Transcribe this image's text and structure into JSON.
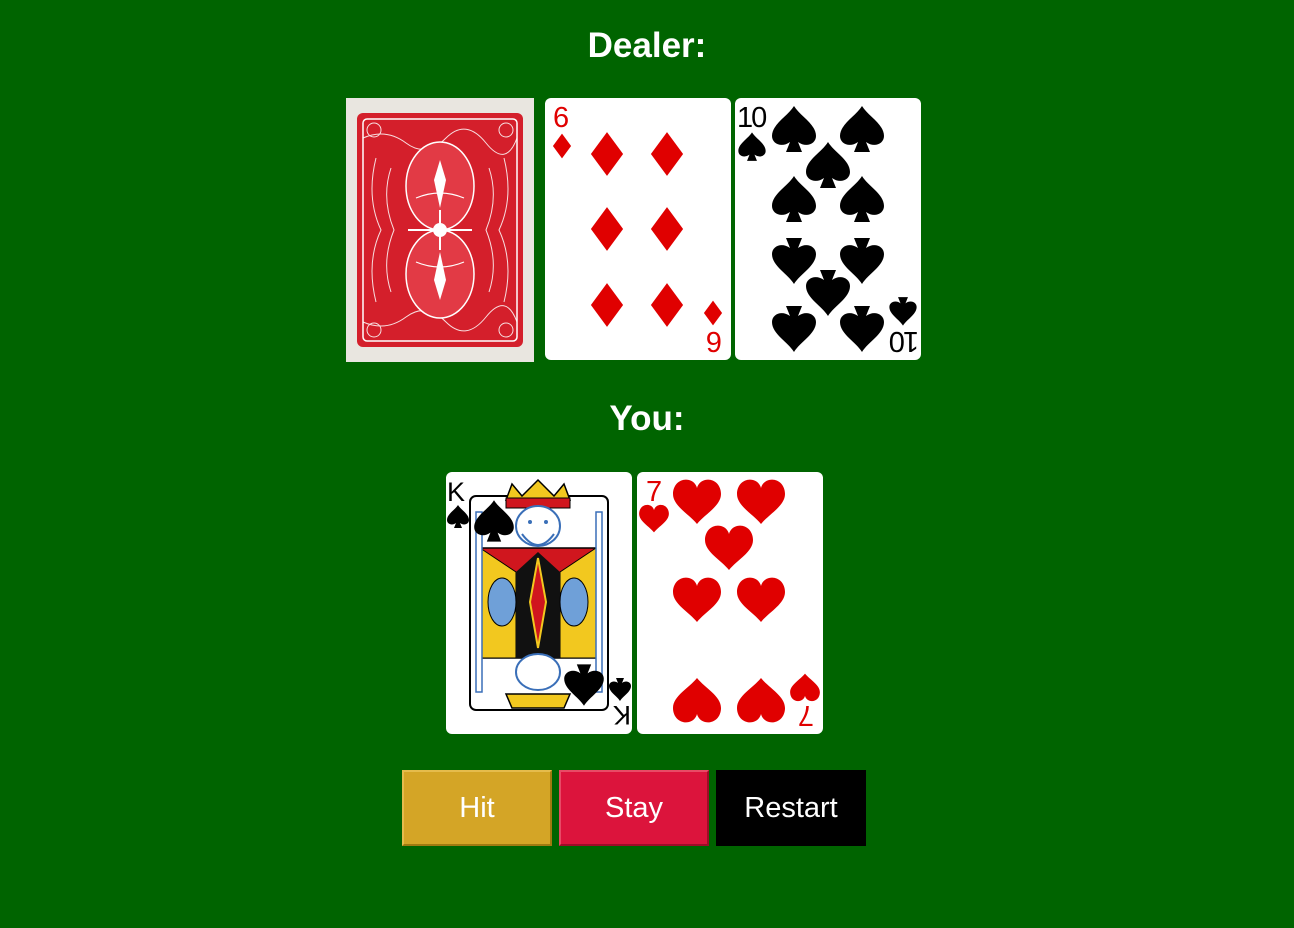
{
  "dealer": {
    "title": "Dealer:",
    "cards": [
      {
        "face": "back",
        "color": "red"
      },
      {
        "rank": "6",
        "suit": "diamonds",
        "suit_symbol": "♦",
        "color": "#E00000"
      },
      {
        "rank": "10",
        "suit": "spades",
        "suit_symbol": "♠",
        "color": "#000000"
      }
    ]
  },
  "player": {
    "title": "You:",
    "cards": [
      {
        "rank": "K",
        "suit": "spades",
        "suit_symbol": "♠",
        "color": "#000000"
      },
      {
        "rank": "7",
        "suit": "hearts",
        "suit_symbol": "♥",
        "color": "#E00000"
      }
    ]
  },
  "controls": {
    "hit_label": "Hit",
    "stay_label": "Stay",
    "restart_label": "Restart"
  },
  "colors": {
    "table": "#006400",
    "hit": "#D4A526",
    "stay": "#DC143C",
    "restart": "#000000"
  }
}
